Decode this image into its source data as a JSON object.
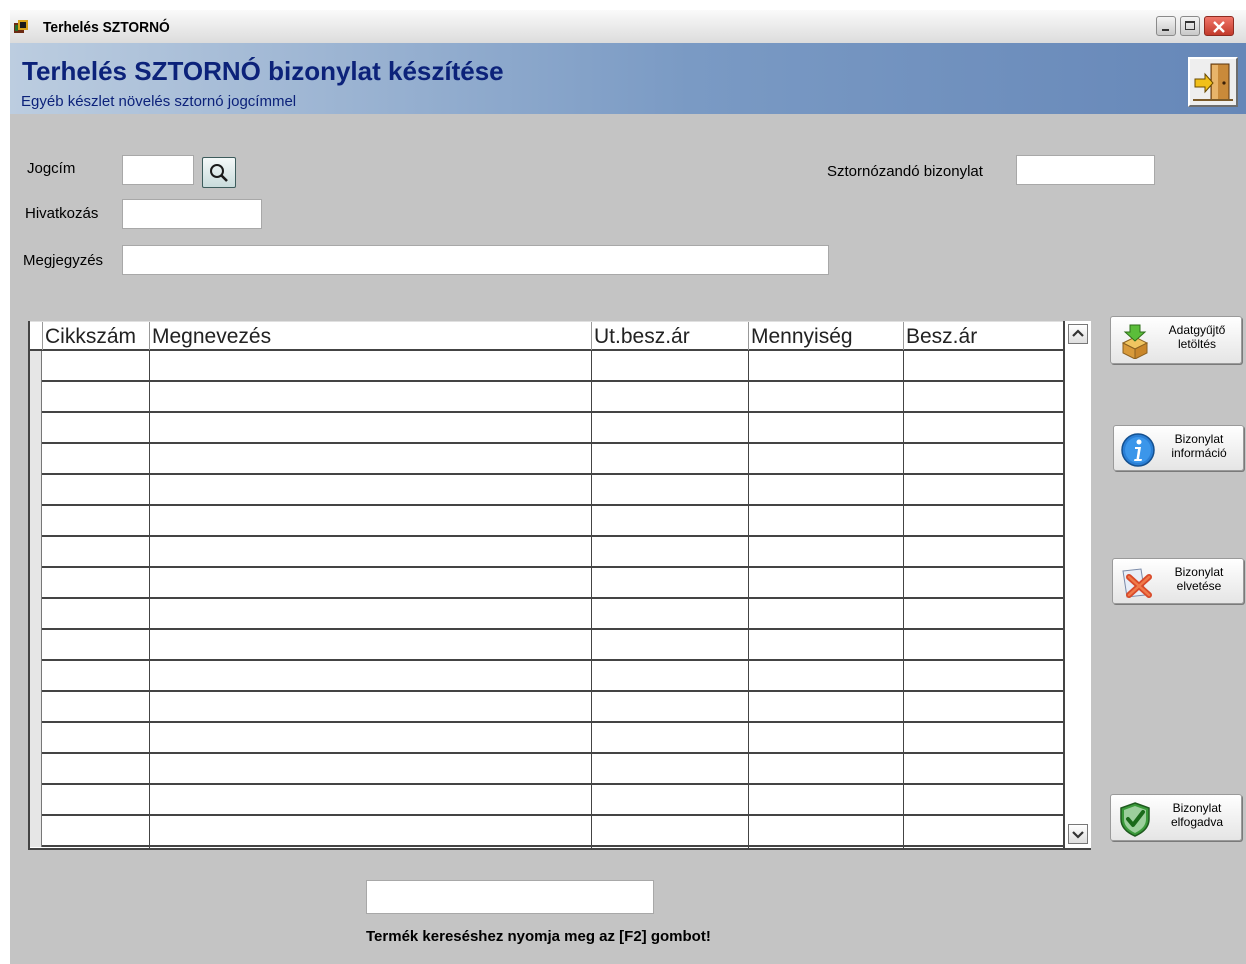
{
  "window": {
    "title": "Terhelés SZTORNÓ"
  },
  "banner": {
    "title": "Terhelés SZTORNÓ bizonylat készítése",
    "subtitle": "Egyéb készlet növelés sztornó jogcímmel"
  },
  "form": {
    "jogcim_label": "Jogcím",
    "jogcim_value": "",
    "hivatkozas_label": "Hivatkozás",
    "hivatkozas_value": "",
    "megjegyzes_label": "Megjegyzés",
    "megjegyzes_value": "",
    "sztornozando_label": "Sztornózandó bizonylat",
    "sztornozando_value": ""
  },
  "grid": {
    "columns": [
      "Cikkszám",
      "Megnevezés",
      "Ut.besz.ár",
      "Mennyiség",
      "Besz.ár"
    ],
    "empty_rows": 16
  },
  "side_buttons": [
    {
      "line1": "Adatgyűjtő",
      "line2": "letöltés",
      "icon": "box-download-icon"
    },
    {
      "line1": "Bizonylat",
      "line2": "információ",
      "icon": "info-icon"
    },
    {
      "line1": "Bizonylat",
      "line2": "elvetése",
      "icon": "reject-x-icon"
    },
    {
      "line1": "Bizonylat",
      "line2": "elfogadva",
      "icon": "accept-shield-icon"
    }
  ],
  "footer": {
    "product_search_value": "",
    "hint": "Termék kereséshez nyomja meg az [F2] gombot!"
  },
  "colors": {
    "banner_text": "#0c227a",
    "window_bg": "#c4c4c4",
    "close_red": "#c23a2b"
  }
}
